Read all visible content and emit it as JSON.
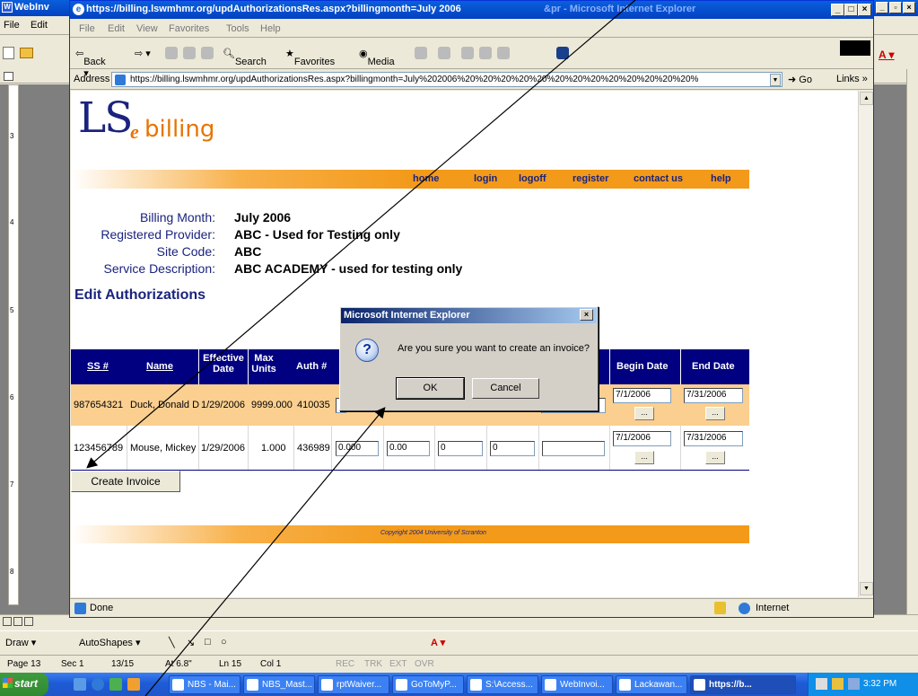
{
  "word": {
    "title": "WebInv",
    "menu": [
      "File",
      "Edit"
    ],
    "status": {
      "page": "Page 13",
      "sec": "Sec 1",
      "pages": "13/15",
      "at": "At 6.8\"",
      "ln": "Ln 15",
      "col": "Col 1",
      "modes": [
        "REC",
        "TRK",
        "EXT",
        "OVR"
      ]
    },
    "draw_toolbar": {
      "draw": "Draw ▾",
      "autoshapes": "AutoShapes ▾"
    },
    "ruler_numbers": [
      "3",
      "4",
      "5",
      "6",
      "7",
      "8"
    ]
  },
  "ie": {
    "title": "https://billing.lswmhmr.org/updAuthorizationsRes.aspx?billingmonth=July 2006",
    "title_suffix": "&pr - Microsoft Internet Explorer",
    "menu": [
      "File",
      "Edit",
      "View",
      "Favorites",
      "Tools",
      "Help"
    ],
    "toolbar": {
      "back": "Back ▾",
      "search": "Search",
      "favorites": "Favorites",
      "media": "Media"
    },
    "address_label": "Address",
    "address": "https://billing.lswmhmr.org/updAuthorizationsRes.aspx?billingmonth=July%202006%20%20%20%20%20%20%20%20%20%20%20%20%20%",
    "go": "Go",
    "links": "Links »",
    "status_text": "Done",
    "zone": "Internet"
  },
  "page": {
    "logo_main": "LS",
    "logo_e": "e",
    "logo_billing": "billing",
    "nav": [
      "home",
      "login",
      "logoff",
      "register",
      "contact us",
      "help"
    ],
    "info": [
      {
        "label": "Billing Month:",
        "value": "July 2006"
      },
      {
        "label": "Registered Provider:",
        "value": "ABC - Used for Testing only"
      },
      {
        "label": "Site Code:",
        "value": "ABC"
      },
      {
        "label": "Service Description:",
        "value": "ABC ACADEMY - used for testing only"
      }
    ],
    "section_title": "Edit Authorizations",
    "columns": {
      "ss": "SS #",
      "name": "Name",
      "effective": "Effective Date",
      "max": "Max Units",
      "auth": "Auth #",
      "begin": "Begin Date",
      "end": "End Date"
    },
    "rows": [
      {
        "ss": "987654321",
        "name": "Duck, Donald D",
        "effective": "1/29/2006",
        "max": "9999.000",
        "auth": "410035",
        "inputs": [
          "",
          "",
          "",
          "",
          ""
        ],
        "begin": "7/1/2006",
        "end": "7/31/2006"
      },
      {
        "ss": "123456789",
        "name": "Mouse, Mickey",
        "effective": "1/29/2006",
        "max": "1.000",
        "auth": "436989",
        "inputs": [
          "0.000",
          "0.00",
          "0",
          "0",
          ""
        ],
        "begin": "7/1/2006",
        "end": "7/31/2006"
      }
    ],
    "create_button": "Create Invoice",
    "footer": "Copyright 2004  University of Scranton",
    "picker": "..."
  },
  "dialog": {
    "title": "Microsoft Internet Explorer",
    "message": "Are you sure you want to create an invoice?",
    "ok": "OK",
    "cancel": "Cancel",
    "icon": "?"
  },
  "taskbar": {
    "start": "start",
    "items": [
      {
        "label": "NBS - Mai...",
        "active": false
      },
      {
        "label": "NBS_Mast...",
        "active": false
      },
      {
        "label": "rptWaiver...",
        "active": false
      },
      {
        "label": "GoToMyP...",
        "active": false
      },
      {
        "label": "S:\\Access...",
        "active": false
      },
      {
        "label": "WebInvoi...",
        "active": false
      },
      {
        "label": "Lackawan...",
        "active": false
      },
      {
        "label": "https://b...",
        "active": true
      }
    ],
    "clock": "3:32 PM"
  },
  "colors": {
    "brand_navy": "#1a237e",
    "brand_orange": "#f39a1a",
    "row_highlight": "#fbcf90",
    "grid_header": "#000080"
  }
}
